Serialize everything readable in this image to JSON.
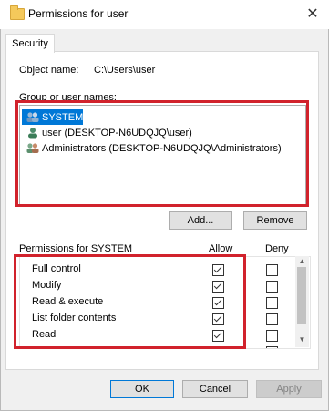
{
  "window": {
    "title": "Permissions for user",
    "close_glyph": "✕"
  },
  "tabs": [
    {
      "label": "Security",
      "active": true
    }
  ],
  "object": {
    "label": "Object name:",
    "value": "C:\\Users\\user"
  },
  "groups": {
    "label": "Group or user names:",
    "items": [
      {
        "label": "SYSTEM",
        "icon": "users-group-icon",
        "selected": true
      },
      {
        "label": "user (DESKTOP-N6UDQJQ\\user)",
        "icon": "user-icon",
        "selected": false
      },
      {
        "label": "Administrators (DESKTOP-N6UDQJQ\\Administrators)",
        "icon": "users-group-icon",
        "selected": false
      }
    ]
  },
  "buttons": {
    "add": "Add...",
    "remove": "Remove",
    "ok": "OK",
    "cancel": "Cancel",
    "apply": "Apply"
  },
  "permissions": {
    "label": "Permissions for SYSTEM",
    "allow_header": "Allow",
    "deny_header": "Deny",
    "rows": [
      {
        "name": "Full control",
        "allow": true,
        "deny": false
      },
      {
        "name": "Modify",
        "allow": true,
        "deny": false
      },
      {
        "name": "Read & execute",
        "allow": true,
        "deny": false
      },
      {
        "name": "List folder contents",
        "allow": true,
        "deny": false
      },
      {
        "name": "Read",
        "allow": true,
        "deny": false
      },
      {
        "name": "",
        "allow": true,
        "deny": false
      }
    ]
  },
  "colors": {
    "selection": "#0078d7",
    "highlight_box": "#d1222c"
  }
}
